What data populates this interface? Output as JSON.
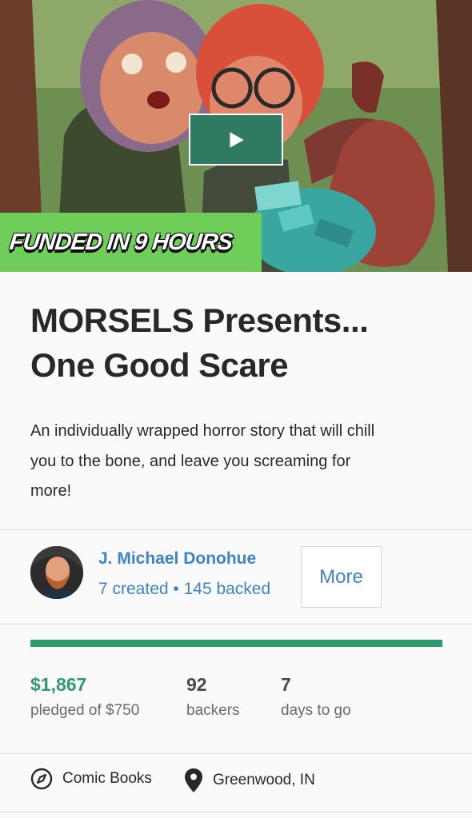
{
  "hero": {
    "banner_text": "FUNDED IN 9 HOURS",
    "play_icon": "play-icon",
    "banner_color": "#6fce5a",
    "play_button_color": "#2f7a62"
  },
  "project": {
    "title_line1": "MORSELS Presents...",
    "title_line2": "One Good Scare",
    "blurb_line1": "An individually wrapped horror story that will chill",
    "blurb_line2": "you to the bone, and leave you screaming for",
    "blurb_line3": "more!"
  },
  "creator": {
    "name": "J. Michael Donohue",
    "stats": "7 created • 145 backed",
    "more_label": "More",
    "link_color": "#3c83c9"
  },
  "funding": {
    "progress_percent": 100,
    "progress_color": "#2e9a6e",
    "pledged": "$1,867",
    "pledged_label": "pledged of $750",
    "backers": "92",
    "backers_label": "backers",
    "days": "7",
    "days_label": "days to go"
  },
  "tags": {
    "category": "Comic Books",
    "category_icon": "compass-icon",
    "location": "Greenwood, IN",
    "location_icon": "location-pin-icon"
  }
}
